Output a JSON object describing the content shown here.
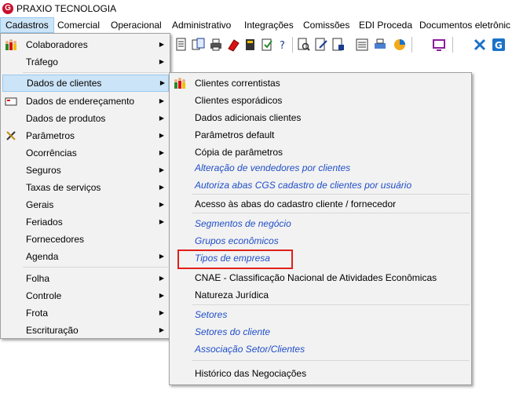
{
  "app": {
    "title": "PRAXIO TECNOLOGIA"
  },
  "menubar": [
    "Cadastros",
    "Comercial",
    "Operacional",
    "Administrativo",
    "Integrações",
    "Comissões",
    "EDI Proceda",
    "Documentos eletrônic"
  ],
  "cadastros_menu": [
    "Colaboradores",
    "Tráfego",
    "Dados de clientes",
    "Dados de endereçamento",
    "Dados de produtos",
    "Parâmetros",
    "Ocorrências",
    "Seguros",
    "Taxas de serviços",
    "Gerais",
    "Feriados",
    "Fornecedores",
    "Agenda",
    "Folha",
    "Controle",
    "Frota",
    "Escrituração"
  ],
  "clientes_submenu": [
    "Clientes correntistas",
    "Clientes esporádicos",
    "Dados adicionais clientes",
    "Parâmetros default",
    "Cópia de parâmetros",
    "Alteração de vendedores por clientes",
    "Autoriza abas CGS cadastro de clientes por usuário",
    "Acesso às abas do cadastro cliente / fornecedor",
    "Segmentos de negócio",
    "Grupos econômicos",
    "Tipos de empresa",
    "CNAE - Classificação Nacional de Atividades Econômicas",
    "Natureza Jurídica",
    "Setores",
    "Setores do cliente",
    "Associação Setor/Clientes",
    "Histórico das Negociações"
  ],
  "colors": {
    "highlight": "#cce4f7",
    "link_blue": "#1f4ec8",
    "annotation_red": "#e0201a"
  },
  "icons": {
    "app": "praxio-logo",
    "colaboradores": "people-icon",
    "enderecamento": "envelope-icon",
    "parametros": "tools-icon",
    "clientes_correntistas": "people-icon"
  }
}
